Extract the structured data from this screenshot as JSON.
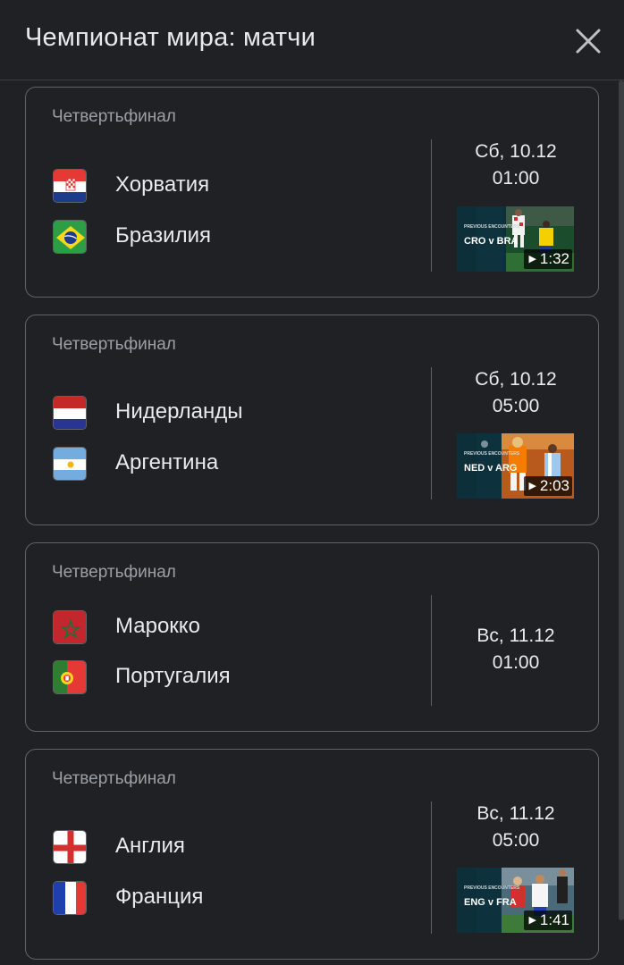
{
  "header": {
    "title": "Чемпионат мира: матчи",
    "close_icon": "close-icon"
  },
  "matches": [
    {
      "stage": "Четвертьфинал",
      "team1": {
        "name": "Хорватия",
        "flag": "croatia-flag"
      },
      "team2": {
        "name": "Бразилия",
        "flag": "brazil-flag"
      },
      "day": "Сб, 10.12",
      "time": "01:00",
      "video": {
        "tag": "PREVIOUS ENCOUNTERS",
        "teams": "CRO v BRA",
        "duration": "1:32"
      }
    },
    {
      "stage": "Четвертьфинал",
      "team1": {
        "name": "Нидерланды",
        "flag": "netherlands-flag"
      },
      "team2": {
        "name": "Аргентина",
        "flag": "argentina-flag"
      },
      "day": "Сб, 10.12",
      "time": "05:00",
      "video": {
        "tag": "PREVIOUS ENCOUNTERS",
        "teams": "NED v ARG",
        "duration": "2:03"
      }
    },
    {
      "stage": "Четвертьфинал",
      "team1": {
        "name": "Марокко",
        "flag": "morocco-flag"
      },
      "team2": {
        "name": "Португалия",
        "flag": "portugal-flag"
      },
      "day": "Вс, 11.12",
      "time": "01:00"
    },
    {
      "stage": "Четвертьфинал",
      "team1": {
        "name": "Англия",
        "flag": "england-flag"
      },
      "team2": {
        "name": "Франция",
        "flag": "france-flag"
      },
      "day": "Вс, 11.12",
      "time": "05:00",
      "video": {
        "tag": "PREVIOUS ENCOUNTERS",
        "teams": "ENG v FRA",
        "duration": "1:41"
      }
    }
  ],
  "colors": {
    "background": "#202124",
    "card_border": "#5f6368",
    "primary_text": "#e8eaed",
    "secondary_text": "#9aa0a6"
  }
}
